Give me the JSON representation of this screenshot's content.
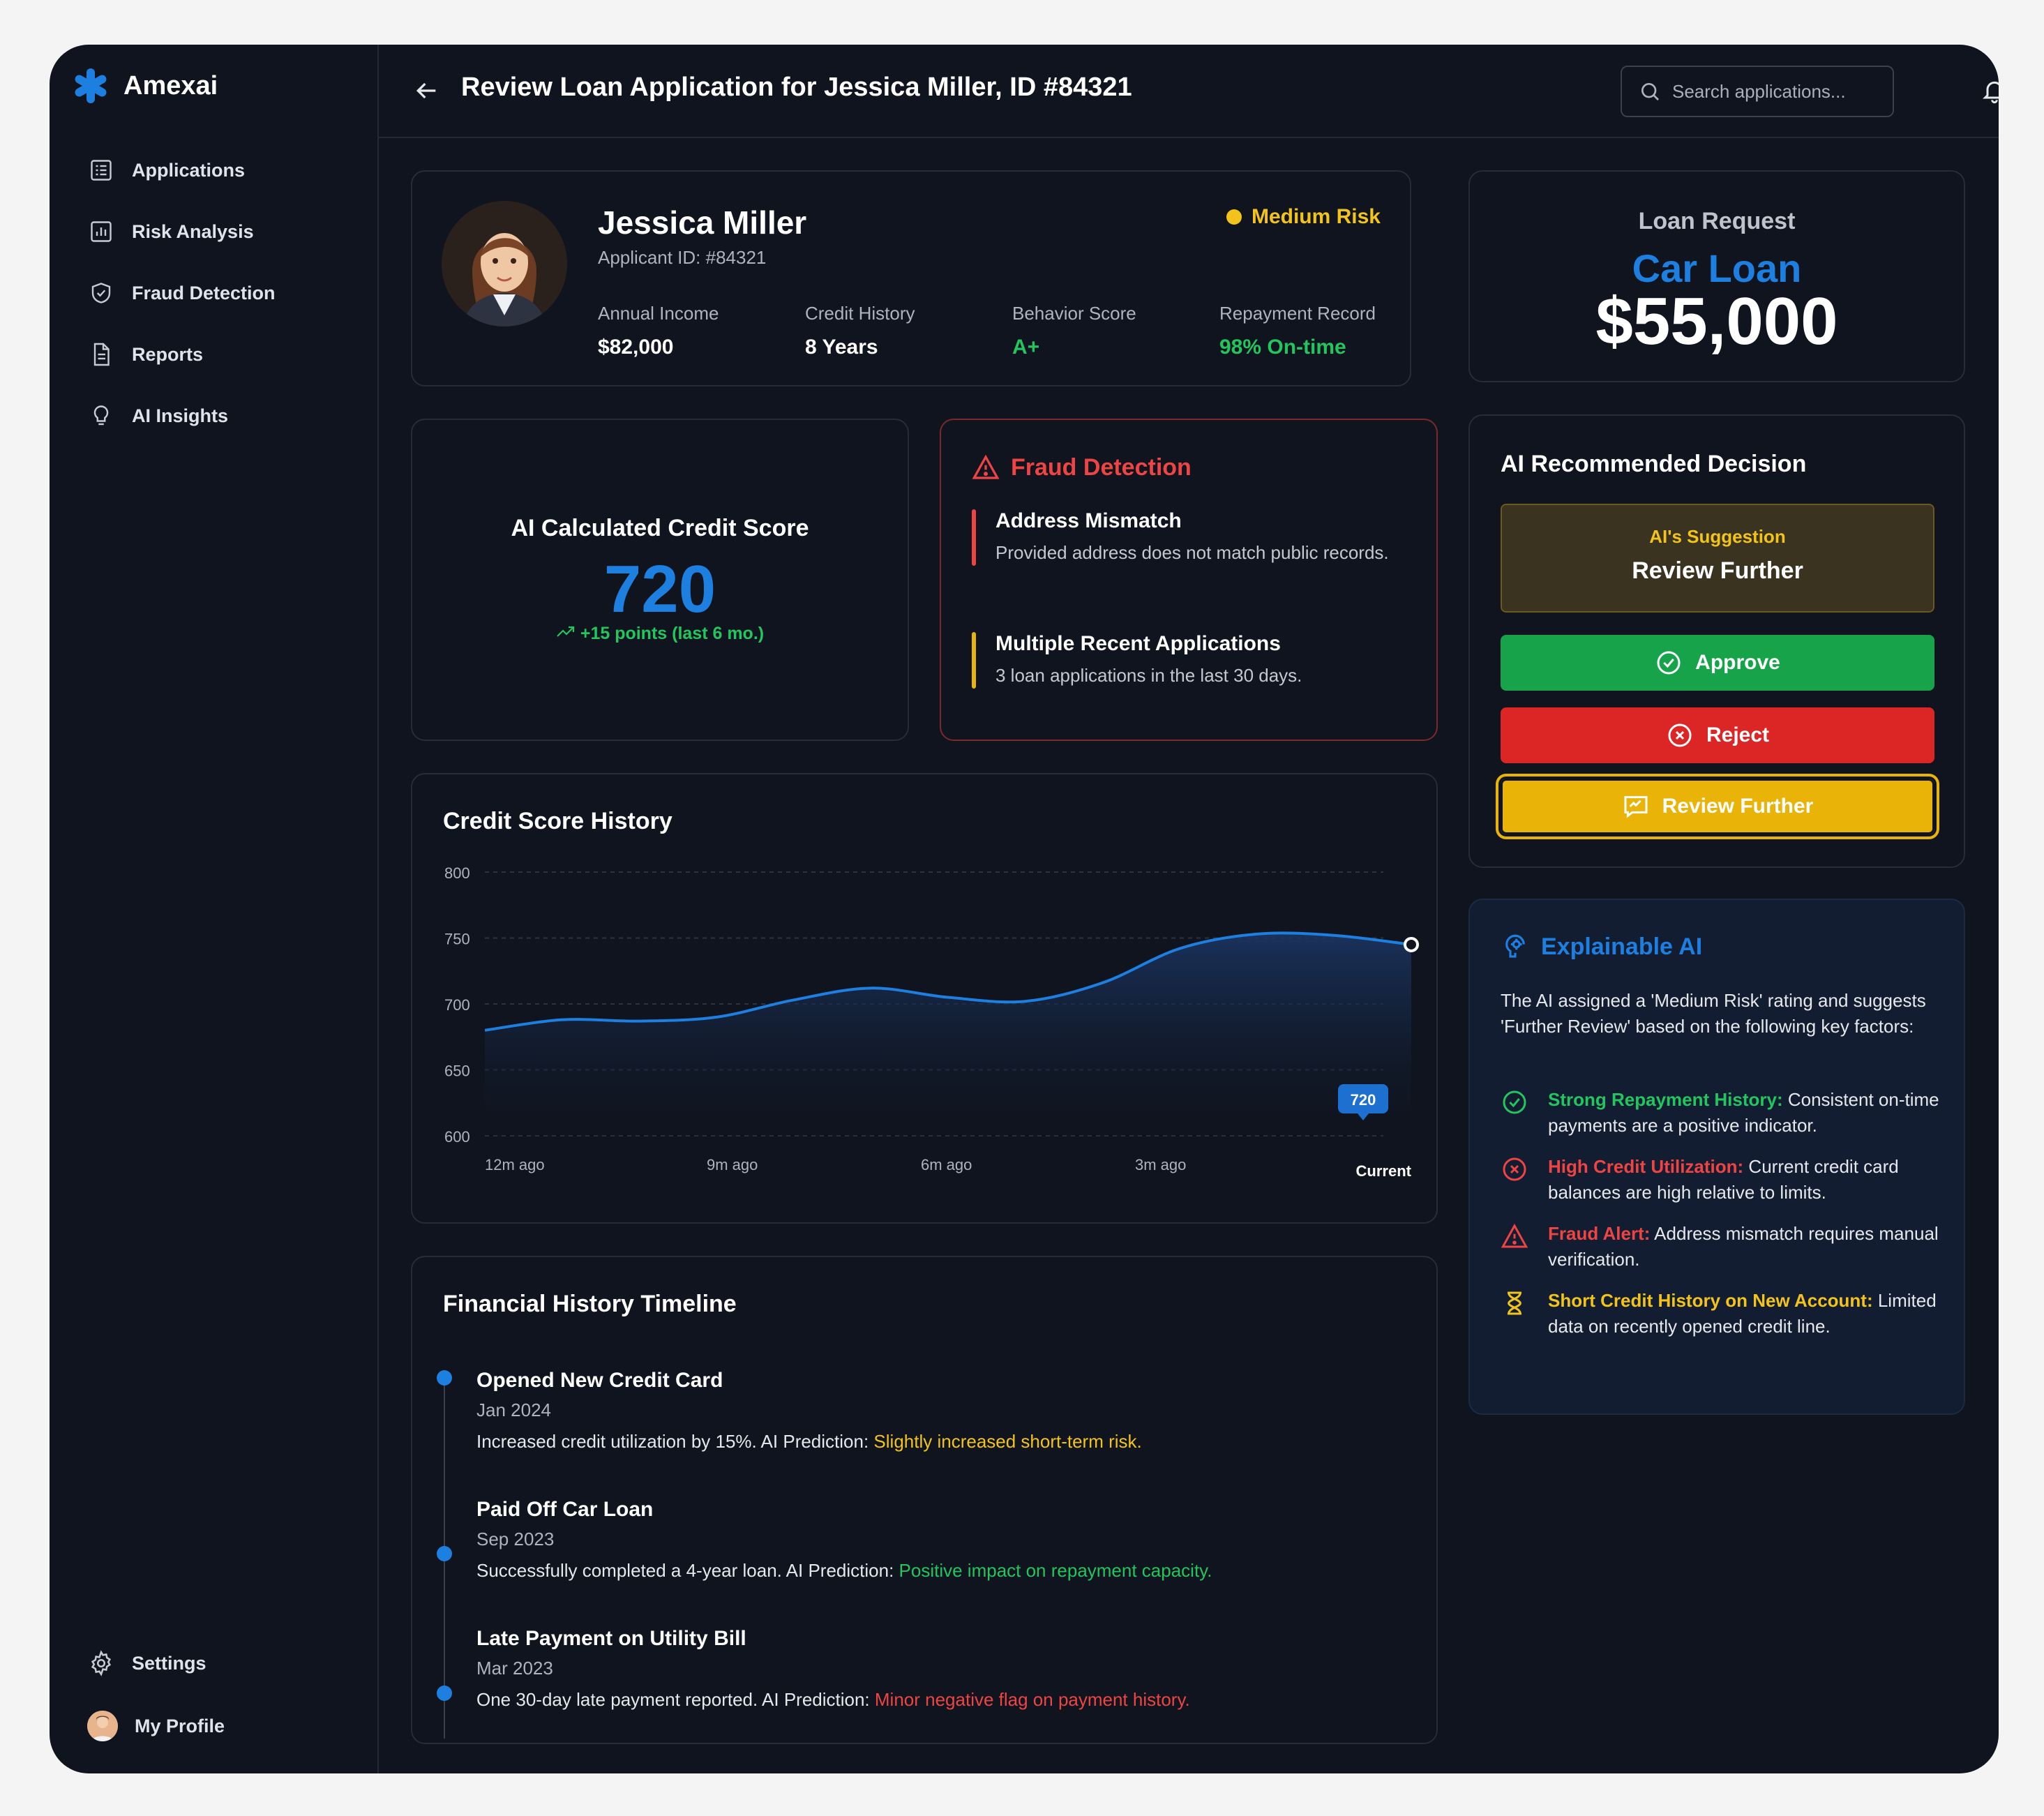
{
  "brand": {
    "name": "Amexai",
    "color": "#1d7fe0"
  },
  "sidebar": {
    "items": [
      {
        "label": "Applications",
        "icon": "list-icon"
      },
      {
        "label": "Risk Analysis",
        "icon": "bar-chart-icon"
      },
      {
        "label": "Fraud Detection",
        "icon": "shield-icon"
      },
      {
        "label": "Reports",
        "icon": "document-icon"
      },
      {
        "label": "AI Insights",
        "icon": "lightbulb-icon"
      }
    ],
    "footer": [
      {
        "label": "Settings",
        "icon": "gear-icon"
      },
      {
        "label": "My Profile",
        "icon": "avatar"
      }
    ]
  },
  "header": {
    "title": "Review Loan Application for Jessica Miller, ID #84321",
    "search_placeholder": "Search applications..."
  },
  "applicant": {
    "name": "Jessica Miller",
    "id": "Applicant ID: #84321",
    "risk": "Medium Risk",
    "stats": [
      {
        "label": "Annual Income",
        "value": "$82,000"
      },
      {
        "label": "Credit History",
        "value": "8 Years"
      },
      {
        "label": "Behavior Score",
        "value": "A+"
      },
      {
        "label": "Repayment Record",
        "value": "98% On-time"
      }
    ]
  },
  "loan": {
    "label": "Loan Request",
    "type": "Car Loan",
    "amount": "$55,000"
  },
  "credit_score": {
    "title": "AI Calculated Credit Score",
    "score": "720",
    "delta": "+15 points (last 6 mo.)"
  },
  "fraud": {
    "title": "Fraud Detection",
    "items": [
      {
        "title": "Address Mismatch",
        "desc": "Provided address does not match public records.",
        "color": "#ef4444"
      },
      {
        "title": "Multiple Recent Applications",
        "desc": "3 loan applications in the last 30 days.",
        "color": "#eab308"
      }
    ]
  },
  "decision": {
    "title": "AI Recommended Decision",
    "suggestion_label": "AI's Suggestion",
    "suggestion_value": "Review Further",
    "approve": "Approve",
    "reject": "Reject",
    "review": "Review Further"
  },
  "xai": {
    "title": "Explainable AI",
    "intro": "The AI assigned a 'Medium Risk' rating and suggests 'Further Review' based on the following key factors:",
    "factors": [
      {
        "title": "Strong Repayment History:",
        "text": " Consistent on-time payments are a positive indicator.",
        "color": "#22c55e",
        "icon": "check-circle-icon"
      },
      {
        "title": "High Credit Utilization:",
        "text": " Current credit card balances are high relative to limits.",
        "color": "#ef4444",
        "icon": "x-circle-icon"
      },
      {
        "title": "Fraud Alert:",
        "text": " Address mismatch requires manual verification.",
        "color": "#ef4444",
        "icon": "warning-icon"
      },
      {
        "title": "Short Credit History on New Account:",
        "text": " Limited data on recently opened credit line.",
        "color": "#f2c41b",
        "icon": "hourglass-icon"
      }
    ]
  },
  "chart_data": {
    "type": "area",
    "title": "Credit Score History",
    "x": [
      12,
      11,
      10,
      9,
      8,
      7,
      6,
      5,
      4,
      3,
      2,
      1,
      0
    ],
    "x_tick_labels": [
      "12m ago",
      "9m ago",
      "6m ago",
      "3m ago",
      "Current"
    ],
    "values": [
      680,
      688,
      687,
      690,
      703,
      712,
      705,
      702,
      716,
      742,
      753,
      752,
      745
    ],
    "ylim": [
      600,
      800
    ],
    "yticks": [
      800,
      750,
      700,
      650,
      600
    ],
    "grid": true,
    "annotation": "720",
    "line_color": "#1d7fe0"
  },
  "timeline": {
    "title": "Financial History Timeline",
    "items": [
      {
        "title": "Opened New Credit Card",
        "date": "Jan 2024",
        "desc": "Increased credit utilization by 15%. AI Prediction: ",
        "prediction": "Slightly increased short-term risk.",
        "pred_color": "#f2c41b"
      },
      {
        "title": "Paid Off Car Loan",
        "date": "Sep 2023",
        "desc": "Successfully completed a 4-year loan. AI Prediction: ",
        "prediction": "Positive impact on repayment capacity.",
        "pred_color": "#22c55e"
      },
      {
        "title": "Late Payment on Utility Bill",
        "date": "Mar 2023",
        "desc": "One 30-day late payment reported. AI Prediction: ",
        "prediction": "Minor negative flag on payment history.",
        "pred_color": "#ef4444"
      }
    ]
  }
}
